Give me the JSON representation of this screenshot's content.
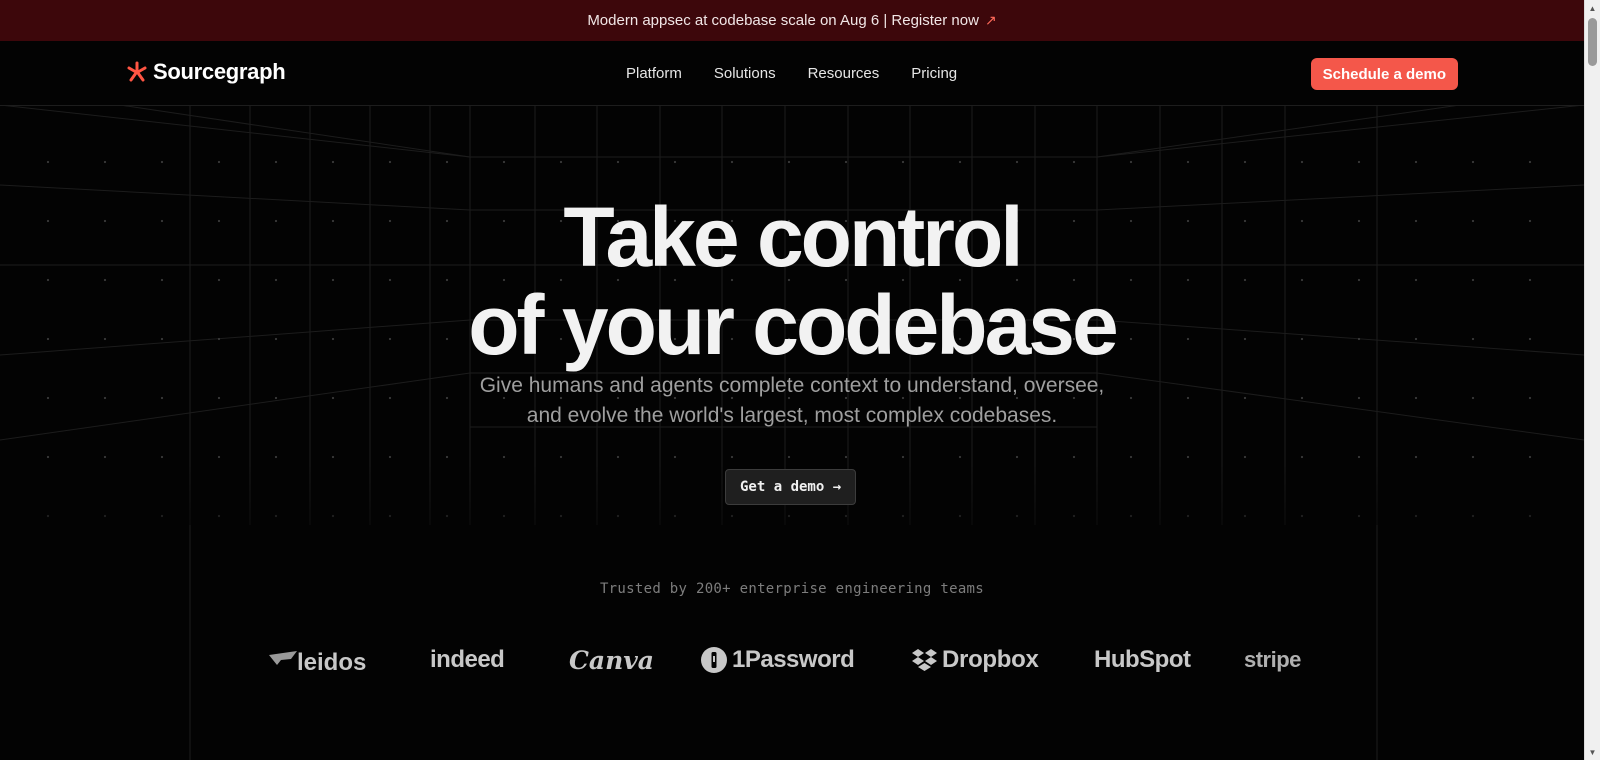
{
  "banner": {
    "text": "Modern appsec at codebase scale on Aug 6 | Register now",
    "arrow": "↗"
  },
  "header": {
    "logo_text": "Sourcegraph",
    "nav": [
      {
        "label": "Platform"
      },
      {
        "label": "Solutions"
      },
      {
        "label": "Resources"
      },
      {
        "label": "Pricing"
      }
    ],
    "cta_label": "Schedule a demo"
  },
  "hero": {
    "title_line1": "Take control",
    "title_line2": "of your codebase",
    "subtitle_line1": "Give humans and agents complete context to understand, oversee,",
    "subtitle_line2": "and evolve the world's largest, most complex codebases.",
    "button_label": "Get a demo →"
  },
  "trusted": {
    "text": "Trusted by 200+ enterprise engineering teams",
    "logos": [
      {
        "name": "leidos"
      },
      {
        "name": "indeed"
      },
      {
        "name": "Canva"
      },
      {
        "name": "1Password"
      },
      {
        "name": "Dropbox"
      },
      {
        "name": "HubSpot"
      },
      {
        "name": "stripe"
      }
    ]
  },
  "colors": {
    "background": "#030303",
    "banner": "#3d070b",
    "accent": "#f4574a",
    "logo_mark": "#ff5543"
  },
  "icons": {
    "logo": "sourcegraph-asterisk-icon",
    "banner_arrow": "arrow-up-right-icon",
    "scroll_up": "triangle-up-icon",
    "scroll_down": "triangle-down-icon"
  }
}
